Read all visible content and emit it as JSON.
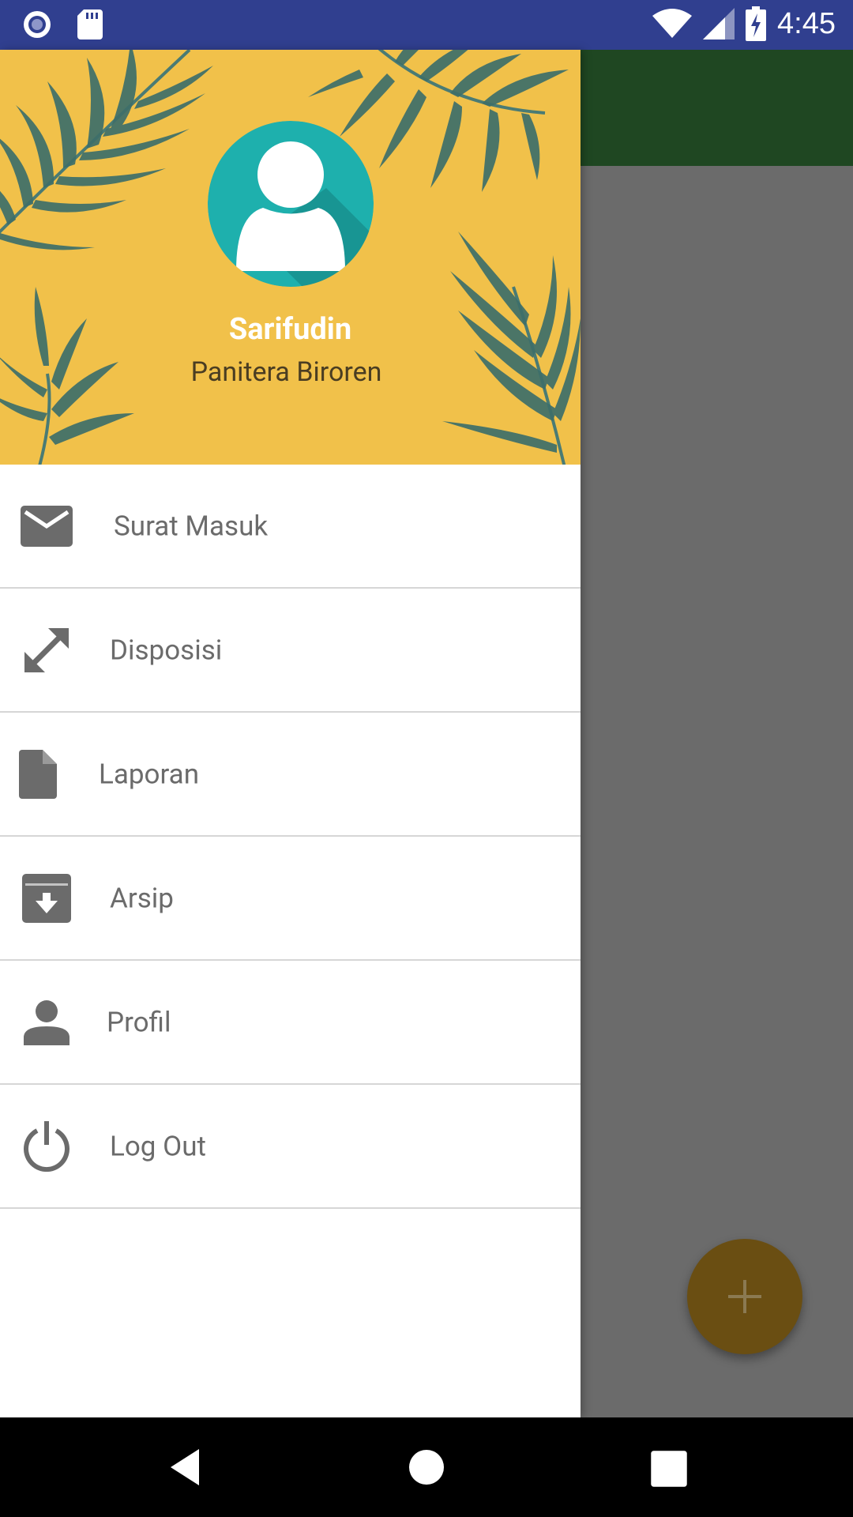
{
  "status_bar": {
    "time": "4:45",
    "icons": [
      "record-icon",
      "sd-card-icon",
      "wifi-icon",
      "signal-icon",
      "battery-charging-icon"
    ]
  },
  "drawer": {
    "user": {
      "name": "Sarifudin",
      "role": "Panitera Biroren"
    },
    "menu": [
      {
        "label": "Surat Masuk",
        "icon": "mail-icon"
      },
      {
        "label": "Disposisi",
        "icon": "expand-arrows-icon"
      },
      {
        "label": "Laporan",
        "icon": "document-icon"
      },
      {
        "label": "Arsip",
        "icon": "archive-icon"
      },
      {
        "label": "Profil",
        "icon": "person-icon"
      },
      {
        "label": "Log Out",
        "icon": "power-icon"
      }
    ]
  },
  "colors": {
    "status_bar": "#303f8f",
    "toolbar": "#1f4722",
    "header_bg": "#f1c14a",
    "fab": "#6a4e12",
    "avatar": "#1eb0ad",
    "menu_text": "#6b6b6b"
  },
  "fab": {
    "icon": "plus-icon"
  },
  "nav_bar": {
    "buttons": [
      "back-icon",
      "home-icon",
      "recents-icon"
    ]
  }
}
